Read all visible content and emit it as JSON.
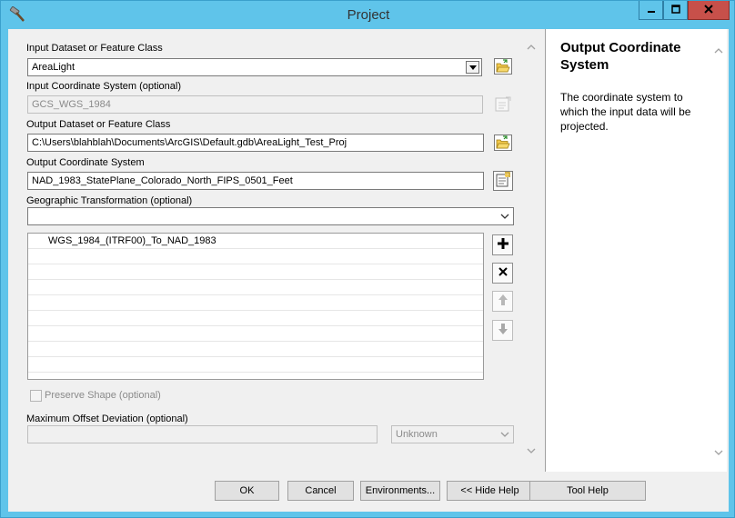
{
  "window": {
    "title": "Project"
  },
  "titlebar_icons": {
    "app": "hammer-icon",
    "minimize": "minimize-icon",
    "maximize": "maximize-icon",
    "close": "close-icon"
  },
  "form": {
    "input_dataset": {
      "label": "Input Dataset or Feature Class",
      "value": "AreaLight"
    },
    "input_coord_system": {
      "label": "Input Coordinate System (optional)",
      "value": "GCS_WGS_1984"
    },
    "output_dataset": {
      "label": "Output Dataset or Feature Class",
      "value": "C:\\Users\\blahblah\\Documents\\ArcGIS\\Default.gdb\\AreaLight_Test_Proj"
    },
    "output_coord_system": {
      "label": "Output Coordinate System",
      "value": "NAD_1983_StatePlane_Colorado_North_FIPS_0501_Feet"
    },
    "geo_transformation": {
      "label": "Geographic Transformation (optional)",
      "value": ""
    },
    "transformations_list": [
      "WGS_1984_(ITRF00)_To_NAD_1983"
    ],
    "preserve_shape": {
      "label": "Preserve Shape (optional)",
      "checked": false
    },
    "max_offset": {
      "label": "Maximum Offset Deviation (optional)",
      "value": "",
      "unit": "Unknown"
    }
  },
  "help": {
    "title": "Output Coordinate System",
    "text": "The coordinate system to which the input data will be projected."
  },
  "buttons": {
    "ok": "OK",
    "cancel": "Cancel",
    "environments": "Environments...",
    "hide_help": "<< Hide Help",
    "tool_help": "Tool Help"
  }
}
